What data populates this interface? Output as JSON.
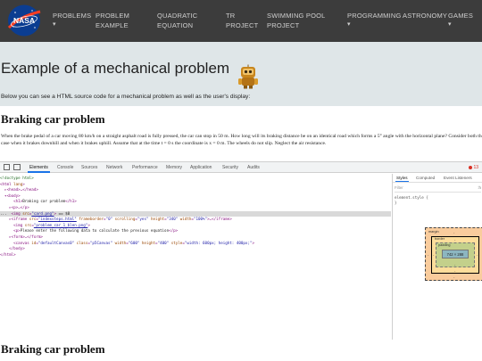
{
  "nav": {
    "logo_text": "NASA",
    "items": [
      {
        "line1": "PROBLEMS",
        "line2": "",
        "caret": "▾"
      },
      {
        "line1": "PROBLEM",
        "line2": "EXAMPLE",
        "caret": ""
      },
      {
        "line1": "QUADRATIC",
        "line2": "EQUATION",
        "caret": ""
      },
      {
        "line1": "TR",
        "line2": "PROJECT",
        "caret": ""
      },
      {
        "line1": "SWIMMING POOL",
        "line2": "PROJECT",
        "caret": ""
      },
      {
        "line1": "PROGRAMMING",
        "line2": "",
        "caret": "▾"
      },
      {
        "line1": "ASTRONOMY",
        "line2": "",
        "caret": ""
      },
      {
        "line1": "GAMES",
        "line2": "",
        "caret": "▾"
      }
    ]
  },
  "hero": {
    "title": "Example of a mechanical problem",
    "subtitle": "Below you can see a HTML source code for a mechanical problem as well as the user's display:"
  },
  "problem": {
    "heading": "Braking car problem",
    "text": "When the brake pedal of a car moving 80 km/h on a straight asphalt road is fully pressed, the car can stop in 50 m. How long will its braking distance be on an identical road which forms a 5° angle with the horizontal plane? Consider both the case when it brakes downhill and when it brakes uphill. Assume that at the time t = 0 s the coordinate is x = 0 m. The wheels do not slip. Neglect the air resistance.",
    "heading_bottom": "Braking car problem"
  },
  "devtools": {
    "tabs": [
      "Elements",
      "Console",
      "Sources",
      "Network",
      "Performance",
      "Memory",
      "Application",
      "Security",
      "Audits"
    ],
    "active_tab": "Elements",
    "error_count": "13",
    "side_tabs": [
      "Styles",
      "Computed",
      "Event Listeners"
    ],
    "filter_placeholder": "Filter",
    "filter_hov": ":h",
    "element_style": "element.style {",
    "element_style_close": "}",
    "box_model": {
      "margin": "margin",
      "border": "border",
      "padding": "padding",
      "content": "742 × 288",
      "dash": "-"
    }
  },
  "code_lines": [
    {
      "sel": false,
      "parts": [
        {
          "c": "t-cmt",
          "t": "<!doctype html>"
        }
      ]
    },
    {
      "sel": false,
      "parts": [
        {
          "c": "t-tag",
          "t": "<html "
        },
        {
          "c": "t-att",
          "t": "lang"
        },
        {
          "c": "t-tag",
          "t": ">"
        }
      ]
    },
    {
      "sel": false,
      "parts": [
        {
          "c": "t-tag",
          "t": "  ▸<head>…</head>"
        }
      ]
    },
    {
      "sel": false,
      "parts": [
        {
          "c": "t-tag",
          "t": "  ▾<body>"
        }
      ]
    },
    {
      "sel": false,
      "parts": [
        {
          "c": "t-tag",
          "t": "      <h1>"
        },
        {
          "c": "t-txt",
          "t": "Braking car problem"
        },
        {
          "c": "t-tag",
          "t": "</h1>"
        }
      ]
    },
    {
      "sel": false,
      "parts": [
        {
          "c": "t-tag",
          "t": "    ▸<p>…</p>"
        }
      ]
    },
    {
      "sel": true,
      "parts": [
        {
          "c": "t-txt",
          "t": "...  "
        },
        {
          "c": "t-tag",
          "t": "<img "
        },
        {
          "c": "t-att",
          "t": "src"
        },
        {
          "c": "t-tag",
          "t": "="
        },
        {
          "c": "t-link",
          "t": "\"card.png\""
        },
        {
          "c": "t-tag",
          "t": "> "
        },
        {
          "c": "t-txt",
          "t": "== $0"
        }
      ]
    },
    {
      "sel": false,
      "parts": [
        {
          "c": "t-tag",
          "t": "    ▸<iframe "
        },
        {
          "c": "t-att",
          "t": "src"
        },
        {
          "c": "t-tag",
          "t": "="
        },
        {
          "c": "t-link",
          "t": "\"indexsteps.html\""
        },
        {
          "c": "t-att",
          "t": " frameborder"
        },
        {
          "c": "t-tag",
          "t": "="
        },
        {
          "c": "t-val",
          "t": "\"0\""
        },
        {
          "c": "t-att",
          "t": " scrolling"
        },
        {
          "c": "t-tag",
          "t": "="
        },
        {
          "c": "t-val",
          "t": "\"yes\""
        },
        {
          "c": "t-att",
          "t": " height"
        },
        {
          "c": "t-tag",
          "t": "="
        },
        {
          "c": "t-val",
          "t": "\"340\""
        },
        {
          "c": "t-att",
          "t": " width"
        },
        {
          "c": "t-tag",
          "t": "="
        },
        {
          "c": "t-val",
          "t": "\"100%\""
        },
        {
          "c": "t-tag",
          "t": ">…</iframe>"
        }
      ]
    },
    {
      "sel": false,
      "parts": [
        {
          "c": "t-tag",
          "t": "      <img "
        },
        {
          "c": "t-att",
          "t": "src"
        },
        {
          "c": "t-tag",
          "t": "="
        },
        {
          "c": "t-link",
          "t": "\"problem_car_1_blen.png\""
        },
        {
          "c": "t-tag",
          "t": ">"
        }
      ]
    },
    {
      "sel": false,
      "parts": [
        {
          "c": "t-tag",
          "t": "      <p>"
        },
        {
          "c": "t-txt",
          "t": "Please enter the following data to calculate the previous equation"
        },
        {
          "c": "t-tag",
          "t": "</p>"
        }
      ]
    },
    {
      "sel": false,
      "parts": [
        {
          "c": "t-tag",
          "t": "    ▸<form>…</form>"
        }
      ]
    },
    {
      "sel": false,
      "parts": [
        {
          "c": "t-tag",
          "t": "      <canvas "
        },
        {
          "c": "t-att",
          "t": "id"
        },
        {
          "c": "t-tag",
          "t": "="
        },
        {
          "c": "t-val",
          "t": "\"defaultCanvas0\""
        },
        {
          "c": "t-att",
          "t": " class"
        },
        {
          "c": "t-tag",
          "t": "="
        },
        {
          "c": "t-val",
          "t": "\"p5Canvas\""
        },
        {
          "c": "t-att",
          "t": " width"
        },
        {
          "c": "t-tag",
          "t": "="
        },
        {
          "c": "t-val",
          "t": "\"600\""
        },
        {
          "c": "t-att",
          "t": " height"
        },
        {
          "c": "t-tag",
          "t": "="
        },
        {
          "c": "t-val",
          "t": "\"400\""
        },
        {
          "c": "t-att",
          "t": " style"
        },
        {
          "c": "t-tag",
          "t": "="
        },
        {
          "c": "t-val",
          "t": "\"width: 600px; height: 400px;\""
        },
        {
          "c": "t-tag",
          "t": ">"
        }
      ]
    },
    {
      "sel": false,
      "parts": [
        {
          "c": "t-tag",
          "t": "    </body>"
        }
      ]
    },
    {
      "sel": false,
      "parts": [
        {
          "c": "t-tag",
          "t": "</html>"
        }
      ]
    }
  ]
}
